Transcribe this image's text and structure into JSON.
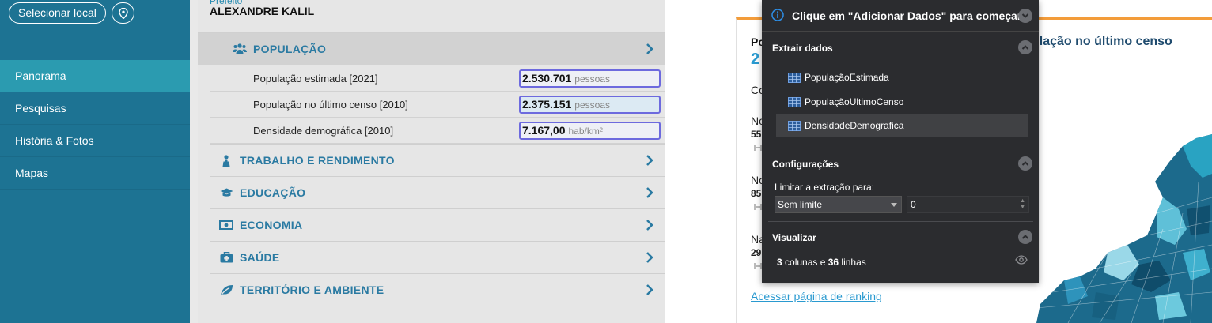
{
  "sidebar": {
    "select_location_label": "Selecionar local",
    "nav": [
      {
        "label": "Panorama",
        "active": true
      },
      {
        "label": "Pesquisas"
      },
      {
        "label": "História & Fotos"
      },
      {
        "label": "Mapas"
      }
    ]
  },
  "main": {
    "prefeito_label": "Prefeito",
    "prefeito_name": "ALEXANDRE KALIL",
    "categories": [
      {
        "label": "POPULAÇÃO",
        "icon": "people-icon"
      },
      {
        "label": "TRABALHO E RENDIMENTO",
        "icon": "worker-icon"
      },
      {
        "label": "EDUCAÇÃO",
        "icon": "graduation-cap-icon"
      },
      {
        "label": "ECONOMIA",
        "icon": "money-icon"
      },
      {
        "label": "SAÚDE",
        "icon": "medkit-icon"
      },
      {
        "label": "TERRITÓRIO E AMBIENTE",
        "icon": "leaf-icon"
      }
    ],
    "population_rows": [
      {
        "label": "População estimada [2021]",
        "value": "2.530.701",
        "unit": "pessoas"
      },
      {
        "label": "População no último censo [2010]",
        "value": "2.375.151",
        "unit": "pessoas"
      },
      {
        "label": "Densidade demográfica [2010]",
        "value": "7.167,00",
        "unit": "hab/km²"
      }
    ]
  },
  "page": {
    "title_left_fragment": "Po",
    "number_fragment": "2",
    "title_right_fragment": "ulação no último censo",
    "fragments": [
      "Co",
      "No",
      "55",
      "No",
      "85",
      "Na",
      "29"
    ],
    "ranking_link": "Acessar página de ranking"
  },
  "panel": {
    "header": "Clique em \"Adicionar Dados\" para começar",
    "extract_title": "Extrair dados",
    "datasets": [
      "PopulaçãoEstimada",
      "PopulaçãoUltimoCenso",
      "DensidadeDemografica"
    ],
    "config_title": "Configurações",
    "limit_label": "Limitar a extração para:",
    "limit_select": "Sem limite",
    "limit_value": "0",
    "view_title": "Visualizar",
    "summary_cols": "3",
    "summary_mid": " colunas e ",
    "summary_rows": "36",
    "summary_end": " linhas"
  },
  "colors": {
    "sidebar_bg": "#1d7393",
    "sidebar_active": "#2b9bb0",
    "accent_blue": "#2a7aa2",
    "value_border": "#6d6ade",
    "panel_bg": "#2b2c2f",
    "page_accent": "#f39c3a"
  }
}
